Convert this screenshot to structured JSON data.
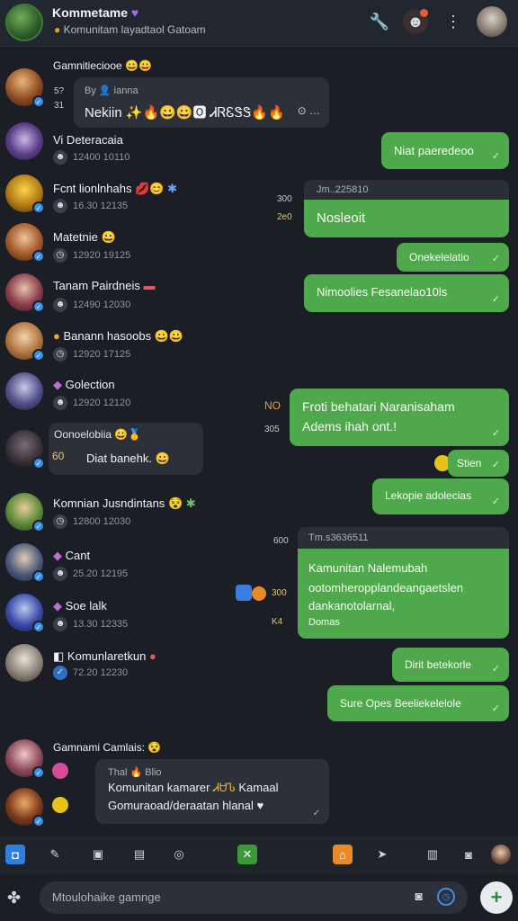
{
  "header": {
    "title": "Kommetame",
    "subtitle": "Komunitam layadtaol Gatoam",
    "title_icon": "purple-heart-badge",
    "icons": [
      "wrench-icon",
      "profile-notification-icon",
      "more-vertical-icon",
      "user-avatar-icon"
    ]
  },
  "feed": [
    {
      "name": "Gamnitieciooe",
      "meta": "",
      "status": "verified"
    },
    {
      "name": "Vi Deteracaia",
      "meta": "12400 10110"
    },
    {
      "name": "Fcnt lionlnhahs",
      "meta": "16.30 12135"
    },
    {
      "name": "Matetnie",
      "meta": "12920 19125"
    },
    {
      "name": "Tanam Pairdneis",
      "meta": "12490 12030"
    },
    {
      "name": "Banann hasoobs",
      "meta": "12920 17125"
    },
    {
      "name": "Golection",
      "meta": "12920 12120"
    },
    {
      "name": "Oonoelobiia",
      "meta": ""
    },
    {
      "name": "Komnian Jusndintans",
      "meta": "12800 12030"
    },
    {
      "name": "Cant",
      "meta": "25.20 12195"
    },
    {
      "name": "Soe lalk",
      "meta": "13.30 12335"
    },
    {
      "name": "Komunlaretkun",
      "meta": "72.20 12230"
    },
    {
      "name": "Gamnami Camlais:",
      "meta": ""
    }
  ],
  "incoming": {
    "first": {
      "head": "By 👤 ianna",
      "text": "Nekiin ✨🔥😀😀🅾 ᏗᏒᏋᏕᏕ🔥🔥",
      "side_top": "5?",
      "side_bottom": "31"
    },
    "second": {
      "text": "Diat banehk.",
      "side": "60"
    },
    "last": {
      "head": "Thal 🔥 Blio",
      "line1": "Komunitan kamarer",
      "highlight": "ᏗᏌᏖ",
      "line1_tail": "Kamaal",
      "line2": "Gomuraoad/deraatan hlanal ♥"
    }
  },
  "outgoing": [
    {
      "text": "Niat paeredeoo"
    },
    {
      "head": "Jm..225810",
      "text": "Nosleoit",
      "side_top": "300",
      "side_bottom": "2e0"
    },
    {
      "text": "Onekelelatio"
    },
    {
      "text": "Nimoolies Fesanelao10ls"
    },
    {
      "line1": "Froti behatari Naranisaham",
      "line2": "Adems ihah ont.!",
      "side_top": "NO",
      "side_bottom": "305"
    },
    {
      "text": "Stien"
    },
    {
      "text": "Lekopie adolecias"
    },
    {
      "head": "Tm.s3636511",
      "line1": "Kamunitan Nalemubah",
      "line2": "ootomheropplandeangaetslen",
      "line3": "dankanotolarnal,",
      "line4": "Domas",
      "side_top": "600",
      "side_mid": "300",
      "side_bottom": "K4"
    },
    {
      "text": "Dirit betekorle"
    },
    {
      "text": "Sure Opes Beeliekelelole"
    }
  ],
  "composer": {
    "placeholder": "Mtoulohaike gamnge"
  },
  "colors": {
    "accent_green": "#4fa84c",
    "bubble_dark": "#2c3039",
    "background": "#1b1e25"
  }
}
